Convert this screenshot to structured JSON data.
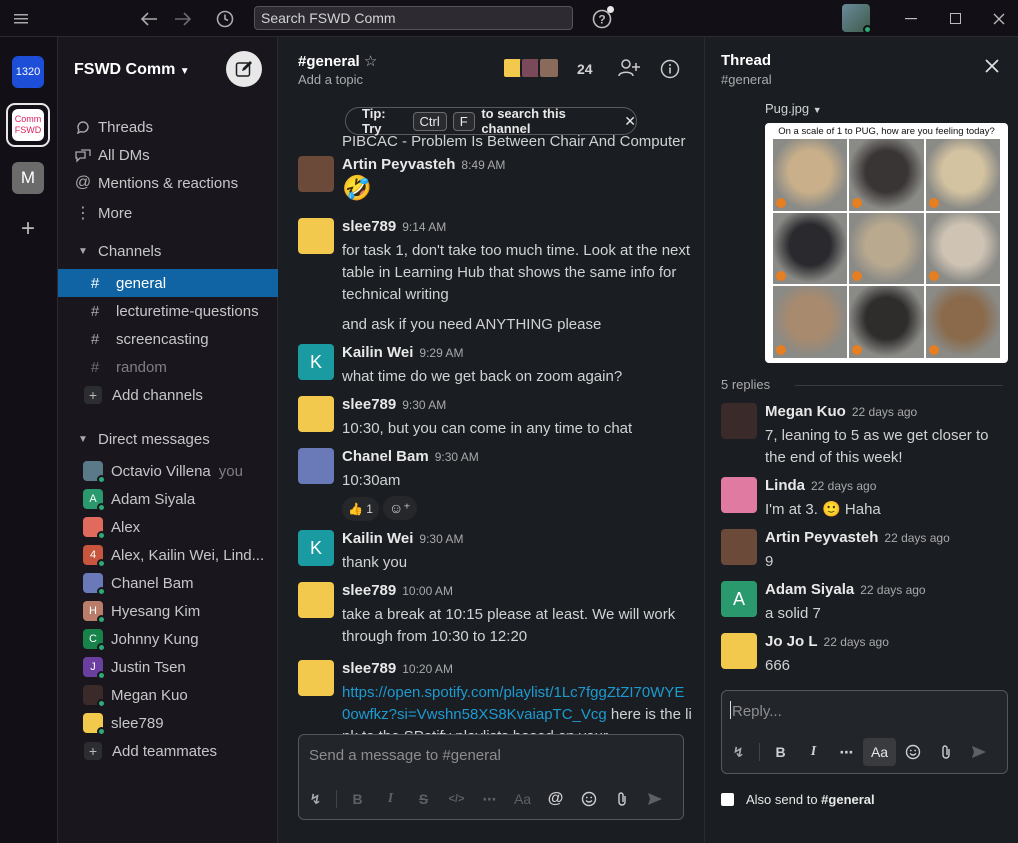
{
  "topbar": {
    "search_placeholder": "Search FSWD Comm",
    "menu_icon": "hamburger-icon",
    "back_icon": "back-arrow-icon",
    "forward_icon": "forward-arrow-icon",
    "history_icon": "clock-icon",
    "help_icon": "help-icon"
  },
  "rail": {
    "workspaces": [
      {
        "label": "1320",
        "color": "#1d4ed8"
      },
      {
        "label": "Comm FSWD",
        "color": "#ffffff"
      },
      {
        "label": "M",
        "color": "#6b6b6b"
      }
    ],
    "add": "+"
  },
  "sidebar": {
    "workspace_name": "FSWD Comm",
    "nav": [
      {
        "label": "Threads",
        "icon": "threads-icon"
      },
      {
        "label": "All DMs",
        "icon": "dms-icon"
      },
      {
        "label": "Mentions & reactions",
        "icon": "at-icon"
      },
      {
        "label": "More",
        "icon": "more-vertical-icon"
      }
    ],
    "channels_header": "Channels",
    "channels": [
      {
        "name": "general",
        "active": true
      },
      {
        "name": "lecturetime-questions",
        "active": false
      },
      {
        "name": "screencasting",
        "active": false
      },
      {
        "name": "random",
        "active": false,
        "muted": true
      }
    ],
    "add_channels": "Add channels",
    "dms_header": "Direct messages",
    "dms": [
      {
        "name": "Octavio Villena",
        "suffix": "you",
        "avatar": "#5a7a8a",
        "letter": ""
      },
      {
        "name": "Adam Siyala",
        "suffix": "",
        "avatar": "#2a9a6e",
        "letter": "A"
      },
      {
        "name": "Alex",
        "suffix": "",
        "avatar": "#e06a5c",
        "letter": ""
      },
      {
        "name": "Alex, Kailin Wei, Lind...",
        "suffix": "",
        "avatar": "#c8553d",
        "letter": "4"
      },
      {
        "name": "Chanel Bam",
        "suffix": "",
        "avatar": "#6a7ab8",
        "letter": ""
      },
      {
        "name": "Hyesang Kim",
        "suffix": "",
        "avatar": "#b97d6a",
        "letter": "H"
      },
      {
        "name": "Johnny Kung",
        "suffix": "",
        "avatar": "#17824a",
        "letter": "C"
      },
      {
        "name": "Justin Tsen",
        "suffix": "",
        "avatar": "#6b3fa0",
        "letter": "J"
      },
      {
        "name": "Megan Kuo",
        "suffix": "",
        "avatar": "#3a2a2a",
        "letter": ""
      },
      {
        "name": "slee789",
        "suffix": "",
        "avatar": "#f2c94c",
        "letter": ""
      }
    ],
    "add_teammates": "Add teammates"
  },
  "channel": {
    "title": "#general",
    "topic": "Add a topic",
    "member_count": "24",
    "tip": {
      "prefix": "Tip: Try",
      "key1": "Ctrl",
      "key2": "F",
      "suffix": "to search this channel"
    },
    "partial_line": "PIBCAC - Problem Is Between Chair And Computer",
    "messages": [
      {
        "name": "Artin Peyvasteh",
        "time": "8:49 AM",
        "lines": [
          "🤣"
        ],
        "avatar": "#6b4a3a",
        "letter": ""
      },
      {
        "name": "slee789",
        "time": "9:14 AM",
        "lines": [
          "for task 1, don't take too much time. Look at the next table in Learning Hub that shows the same info for technical writing",
          "and ask if you need ANYTHING please"
        ],
        "avatar": "#f2c94c",
        "letter": ""
      },
      {
        "name": "Kailin Wei",
        "time": "9:29 AM",
        "lines": [
          "what time do we get back on zoom again?"
        ],
        "avatar": "#1a9ba1",
        "letter": "K"
      },
      {
        "name": "slee789",
        "time": "9:30 AM",
        "lines": [
          "10:30, but you can come in any time to chat"
        ],
        "avatar": "#f2c94c",
        "letter": ""
      },
      {
        "name": "Chanel Bam",
        "time": "9:30 AM",
        "lines": [
          "10:30am"
        ],
        "avatar": "#6a7ab8",
        "letter": "",
        "reaction": "👍 1"
      },
      {
        "name": "Kailin Wei",
        "time": "9:30 AM",
        "lines": [
          "thank you"
        ],
        "avatar": "#1a9ba1",
        "letter": "K"
      },
      {
        "name": "slee789",
        "time": "10:00 AM",
        "lines": [
          "take a break at 10:15 please at least. We will work through from 10:30 to 12:20"
        ],
        "avatar": "#f2c94c",
        "letter": ""
      },
      {
        "name": "slee789",
        "time": "10:20 AM",
        "link": "https://open.spotify.com/playlist/1Lc7fggZtZI70WYE0owfkz?si=Vwshn58XS8KvaiapTC_Vcg",
        "after_link": " here is the link to the SPotify playlists based on your",
        "avatar": "#f2c94c",
        "letter": ""
      }
    ],
    "composer_placeholder": "Send a message to #general"
  },
  "thread": {
    "title": "Thread",
    "subtitle": "#general",
    "file_name": "Pug.jpg",
    "image_caption": "On a scale of 1 to PUG, how are you feeling today?",
    "replies_label": "5 replies",
    "replies": [
      {
        "name": "Megan Kuo",
        "time": "22 days ago",
        "text": "7, leaning to 5 as we get closer to the end of this week!",
        "avatar": "#3a2a2a",
        "letter": ""
      },
      {
        "name": "Linda",
        "time": "22 days ago",
        "text": "I'm at 3. 🙂 Haha",
        "avatar": "#e07aa0",
        "letter": ""
      },
      {
        "name": "Artin Peyvasteh",
        "time": "22 days ago",
        "text": "9",
        "avatar": "#6b4a3a",
        "letter": ""
      },
      {
        "name": "Adam Siyala",
        "time": "22 days ago",
        "text": "a solid 7",
        "avatar": "#2a9a6e",
        "letter": "A"
      },
      {
        "name": "Jo Jo L",
        "time": "22 days ago",
        "text": "666",
        "avatar": "#f2c94c",
        "letter": ""
      }
    ],
    "reply_placeholder": "Reply...",
    "also_send": "Also send to",
    "also_send_channel": "#general"
  }
}
